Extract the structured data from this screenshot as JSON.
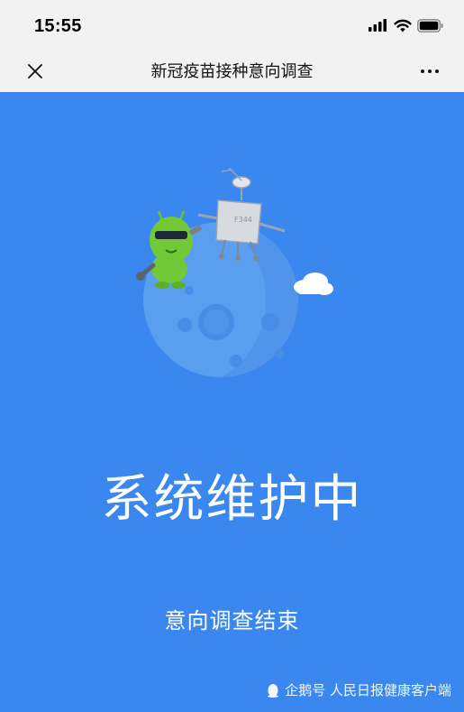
{
  "status_bar": {
    "time": "15:55",
    "icons": [
      "signal-icon",
      "wifi-icon",
      "battery-icon"
    ]
  },
  "nav_bar": {
    "title": "新冠疫苗接种意向调查",
    "close_icon": "close-icon",
    "more_icon": "more-icon"
  },
  "main": {
    "title": "系统维护中",
    "subtitle": "意向调查结束",
    "illustration": "maintenance-illustration"
  },
  "watermark": {
    "text": "企鹅号 人民日报健康客户端",
    "icon": "penguin-icon"
  },
  "colors": {
    "background": "#3a87ef",
    "header": "#f2f2f2",
    "text_on_blue": "#ffffff"
  }
}
